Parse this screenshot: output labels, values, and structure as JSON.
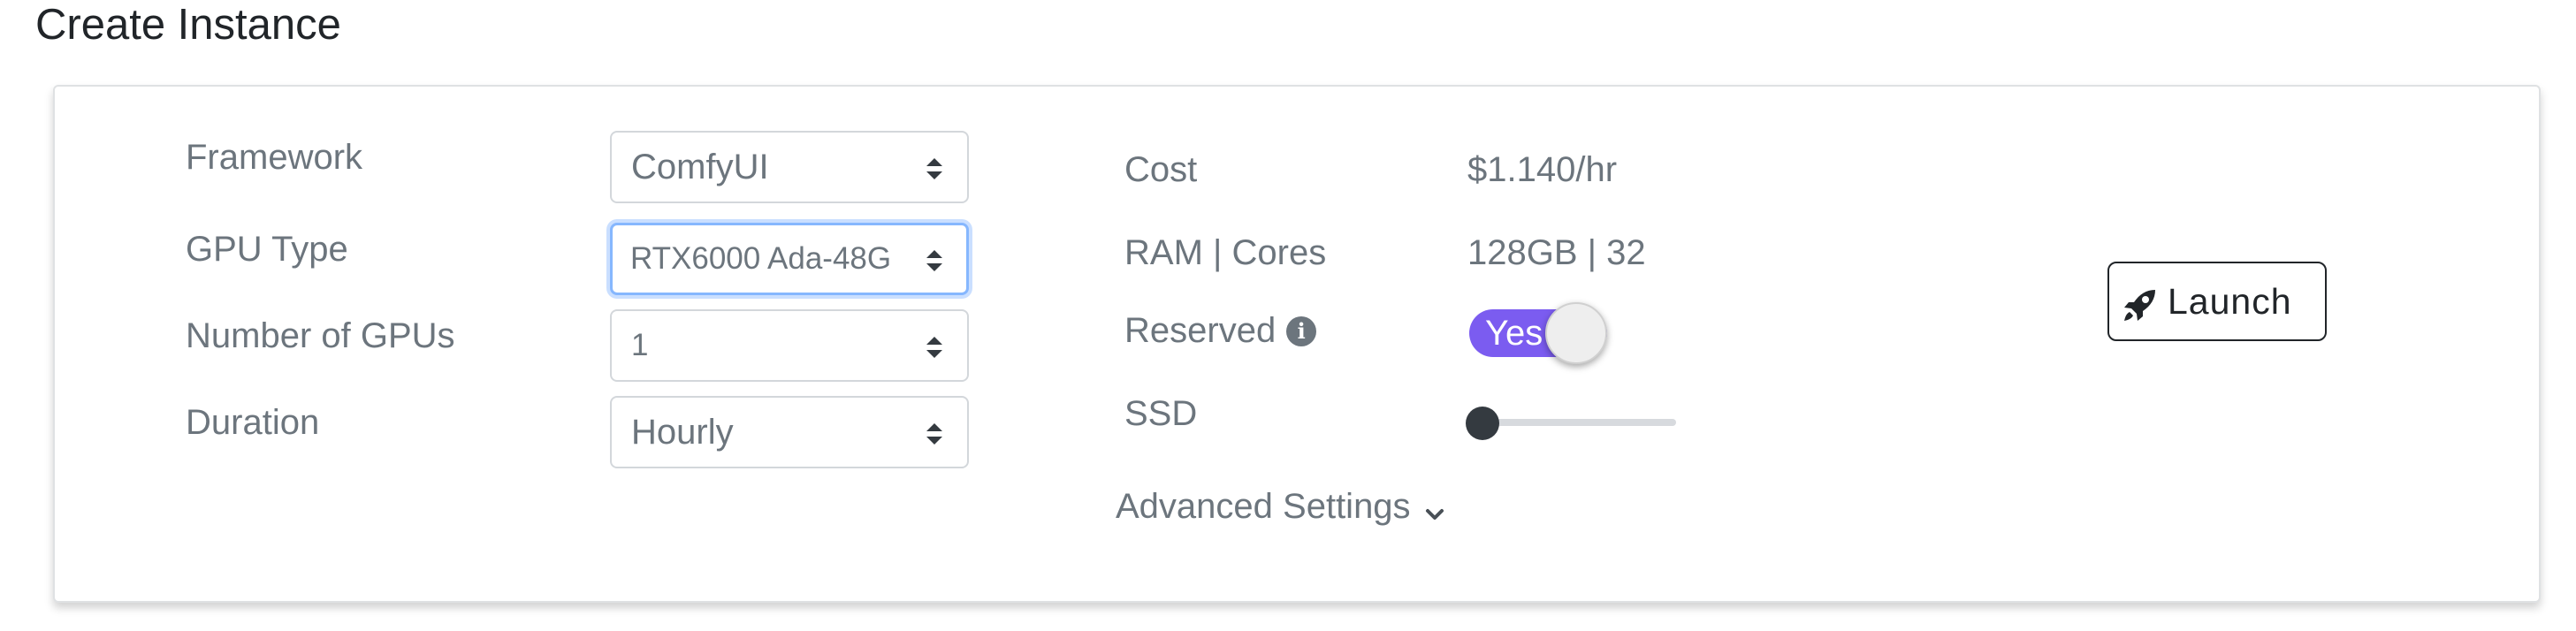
{
  "page": {
    "title": "Create Instance"
  },
  "form": {
    "framework": {
      "label": "Framework",
      "value": "ComfyUI"
    },
    "gpu_type": {
      "label": "GPU Type",
      "value": "RTX6000 Ada-48G"
    },
    "num_gpus": {
      "label": "Number of GPUs",
      "value": "1"
    },
    "duration": {
      "label": "Duration",
      "value": "Hourly"
    }
  },
  "summary": {
    "cost": {
      "label": "Cost",
      "value": "$1.140/hr"
    },
    "ram_cores": {
      "label": "RAM | Cores",
      "value": "128GB | 32"
    },
    "reserved": {
      "label": "Reserved",
      "toggle_text": "Yes",
      "enabled": true,
      "info_icon": "info-circle-icon"
    },
    "ssd": {
      "label": "SSD",
      "slider_fraction": 0.0
    }
  },
  "advanced": {
    "label": "Advanced Settings",
    "icon": "chevron-down-icon"
  },
  "launch": {
    "label": "Launch",
    "icon": "rocket-icon"
  },
  "colors": {
    "toggle_on": "#7b5cf0",
    "focus_ring": "#86b7fe",
    "text_muted": "#6c757d",
    "text_dark": "#212529"
  }
}
